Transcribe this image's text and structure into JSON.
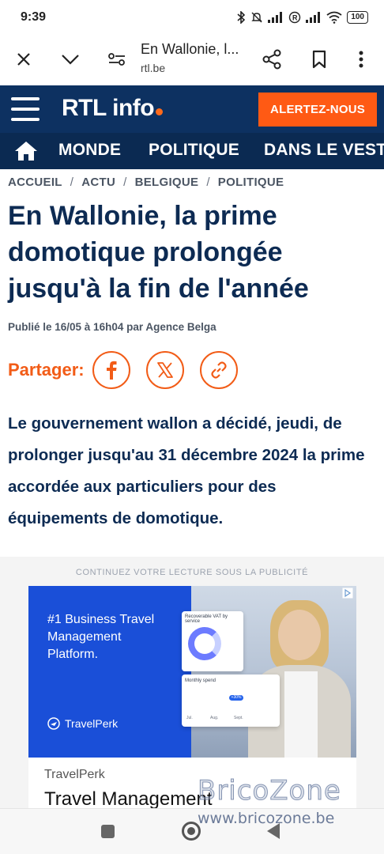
{
  "status": {
    "time": "9:39",
    "battery": "100"
  },
  "browser": {
    "tab_title": "En Wallonie, l...",
    "url": "rtl.be",
    "icons": [
      "close-icon",
      "chevron-down-icon",
      "site-settings-icon",
      "share-icon",
      "bookmark-icon",
      "more-vert-icon"
    ]
  },
  "site": {
    "logo": "RTL info",
    "alert_button": "ALERTEZ-NOUS",
    "brand_color": "#0d3161",
    "accent_color": "#ff5a14"
  },
  "nav": {
    "items": [
      "MONDE",
      "POLITIQUE",
      "DANS LE VEST"
    ]
  },
  "breadcrumb": [
    "ACCUEIL",
    "ACTU",
    "BELGIQUE",
    "POLITIQUE"
  ],
  "article": {
    "title": "En Wallonie, la prime domotique prolongée jusqu'à la fin de l'année",
    "byline": "Publié le 16/05 à 16h04 par Agence Belga",
    "share_label": "Partager:",
    "lead": "Le gouvernement wallon a décidé, jeudi, de prolonger jusqu'au 31 décembre 2024 la prime accordée aux particuliers pour des équipements de domotique."
  },
  "ad": {
    "notice": "CONTINUEZ VOTRE LECTURE SOUS LA PUBLICITÉ",
    "headline": "#1 Business Travel Management Platform.",
    "brand": "TravelPerk",
    "widget1_title": "Recoverable VAT by service",
    "widget2_title": "Monthly spend",
    "widget2_pill": "+30%",
    "widget2_axis": [
      "Jul.",
      "Aug.",
      "Sept."
    ],
    "advertiser": "TravelPerk",
    "title": "Travel Management"
  },
  "watermark": {
    "title": "BricoZone",
    "url": "www.bricozone.be"
  }
}
